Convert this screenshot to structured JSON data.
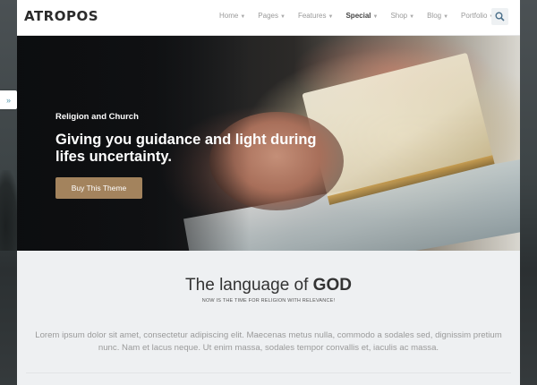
{
  "header": {
    "logo": "ATROPOS",
    "nav": [
      {
        "label": "Home",
        "active": false,
        "has_dropdown": true
      },
      {
        "label": "Pages",
        "active": false,
        "has_dropdown": true
      },
      {
        "label": "Features",
        "active": false,
        "has_dropdown": true
      },
      {
        "label": "Special",
        "active": true,
        "has_dropdown": true
      },
      {
        "label": "Shop",
        "active": false,
        "has_dropdown": true
      },
      {
        "label": "Blog",
        "active": false,
        "has_dropdown": true
      },
      {
        "label": "Portfolio",
        "active": false,
        "has_dropdown": true
      }
    ],
    "search_icon": "search-icon"
  },
  "hero": {
    "subtitle": "Religion and Church",
    "title": "Giving you guidance and light during lifes uncertainty.",
    "button_label": "Buy This Theme",
    "button_color": "#a3835d"
  },
  "drawer": {
    "icon": "double-chevron-right-icon",
    "glyph": "»"
  },
  "content": {
    "title_light": "The language of ",
    "title_bold": "GOD",
    "tagline": "NOW IS THE TIME FOR RELIGION WITH RELEVANCE!",
    "body": "Lorem ipsum dolor sit amet, consectetur adipiscing elit. Maecenas metus nulla, commodo a sodales sed, dignissim pretium nunc. Nam et lacus neque. Ut enim massa, sodales tempor convallis et, iaculis ac massa."
  }
}
